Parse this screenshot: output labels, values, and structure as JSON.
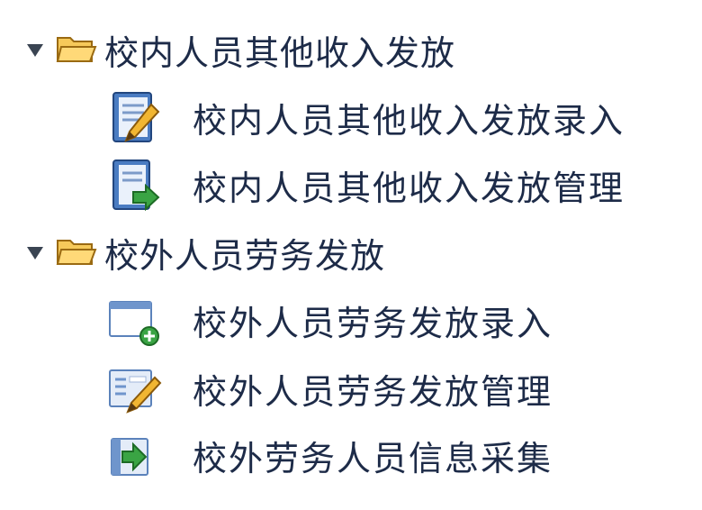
{
  "tree": {
    "groups": [
      {
        "label": "校内人员其他收入发放",
        "expanded": true,
        "items": [
          {
            "label": "校内人员其他收入发放录入",
            "icon": "notebook-pencil-icon"
          },
          {
            "label": "校内人员其他收入发放管理",
            "icon": "notebook-arrow-icon"
          }
        ]
      },
      {
        "label": "校外人员劳务发放",
        "expanded": true,
        "items": [
          {
            "label": "校外人员劳务发放录入",
            "icon": "window-add-icon"
          },
          {
            "label": "校外人员劳务发放管理",
            "icon": "form-edit-icon"
          },
          {
            "label": "校外劳务人员信息采集",
            "icon": "import-arrow-icon"
          }
        ]
      }
    ]
  },
  "colors": {
    "text": "#1d2b48",
    "folder": "#f2b632",
    "icon_blue": "#3f6fb3",
    "icon_green": "#3aa444",
    "pencil": "#e5a526"
  }
}
